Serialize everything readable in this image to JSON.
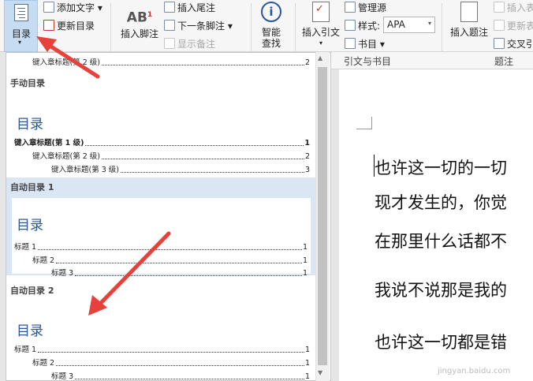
{
  "ribbon": {
    "toc_label": "目录",
    "add_text": "添加文字",
    "update_toc": "更新目录",
    "insert_footnote": "插入脚注",
    "insert_endnote": "插入尾注",
    "next_footnote": "下一条脚注",
    "show_notes": "显示备注",
    "smart_lookup_line1": "智能",
    "smart_lookup_line2": "查找",
    "insert_citation": "插入引文",
    "manage_sources": "管理源",
    "style_label": "样式:",
    "style_value": "APA",
    "bibliography": "书目",
    "citations_group": "引文与书目",
    "insert_caption": "插入题注",
    "insert_table_fig": "插入表",
    "update_table": "更新表",
    "cross_ref": "交叉引",
    "captions_group": "题注",
    "footnote_icon_text": "AB",
    "footnote_icon_sup": "1",
    "smart_icon": "i"
  },
  "gallery": {
    "top_line": {
      "text": "键入章标题(第 2 级)",
      "page": "2"
    },
    "manual": {
      "title": "手动目录",
      "heading": "目录",
      "lines": [
        {
          "text": "键入章标题(第 1 级)",
          "page": "1"
        },
        {
          "text": "键入章标题(第 2 级)",
          "page": "2"
        },
        {
          "text": "键入章标题(第 3 级)",
          "page": "3"
        }
      ]
    },
    "auto1": {
      "title": "自动目录 1",
      "heading": "目录",
      "lines": [
        {
          "text": "标题 1",
          "page": "1"
        },
        {
          "text": "标题 2",
          "page": "1"
        },
        {
          "text": "标题 3",
          "page": "1"
        }
      ]
    },
    "auto2": {
      "title": "自动目录 2",
      "heading": "目录",
      "lines": [
        {
          "text": "标题 1",
          "page": "1"
        },
        {
          "text": "标题 2",
          "page": "1"
        },
        {
          "text": "标题 3",
          "page": "1"
        }
      ]
    }
  },
  "document": {
    "lines": [
      "也许这一切的一切",
      "现才发生的，你觉",
      "在那里什么话都不",
      "我说不说那是我的",
      "也许这一切都是错"
    ]
  },
  "watermark": "jingyan.baidu.com",
  "colors": {
    "accent": "#2b579a",
    "selected": "#dbe6f4",
    "arrow": "#e8413c"
  }
}
